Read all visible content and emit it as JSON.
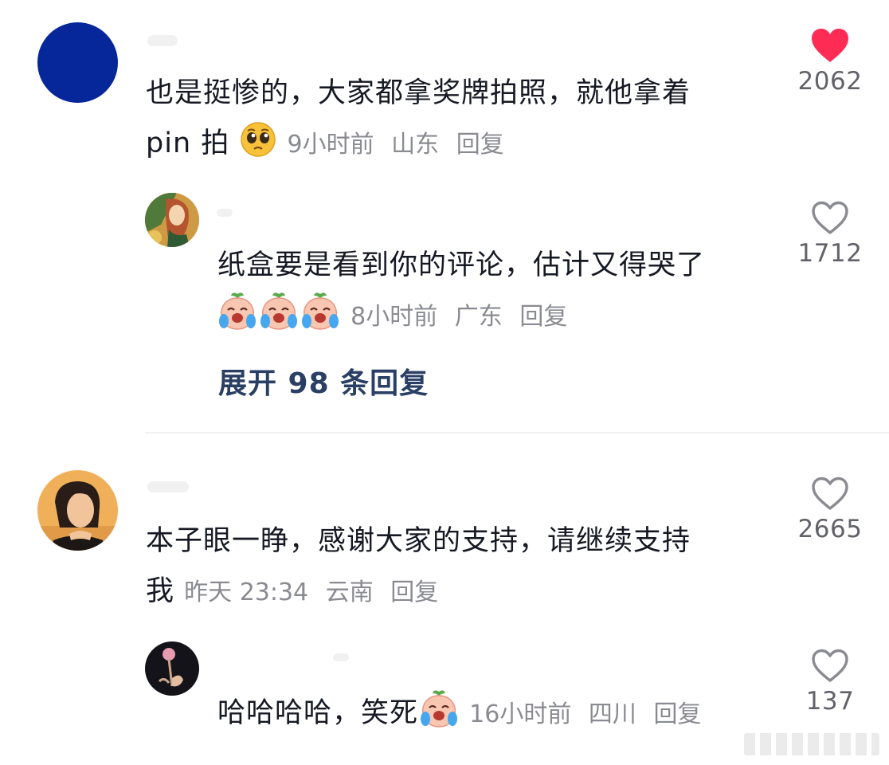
{
  "colors": {
    "liked_heart": "#fe2c55",
    "outline_heart": "#8a8b91",
    "expand_link": "#2a3f64"
  },
  "comments": [
    {
      "text_line1": "也是挺惨的，大家都拿奖牌拍照，就他拿着",
      "text_line2": "pin 拍",
      "emoji": "pleading-face-emoji",
      "time": "9小时前",
      "location": "山东",
      "reply": "回复",
      "likes": "2062",
      "liked": true,
      "replies": [
        {
          "text": "纸盒要是看到你的评论，估计又得哭了",
          "emojis": [
            "crying-peach-emoji",
            "crying-peach-emoji",
            "crying-peach-emoji"
          ],
          "time": "8小时前",
          "location": "广东",
          "reply": "回复",
          "likes": "1712",
          "liked": false
        }
      ],
      "expand": "展开 98 条回复"
    },
    {
      "text_line1": "本子眼一睁，感谢大家的支持，请继续支持",
      "text_line2": "我",
      "time": "昨天 23:34",
      "location": "云南",
      "reply": "回复",
      "likes": "2665",
      "liked": false,
      "replies": [
        {
          "text": "哈哈哈哈，笑死",
          "emojis": [
            "crying-peach-emoji"
          ],
          "time": "16小时前",
          "location": "四川",
          "reply": "回复",
          "likes": "137",
          "liked": false
        }
      ]
    }
  ]
}
